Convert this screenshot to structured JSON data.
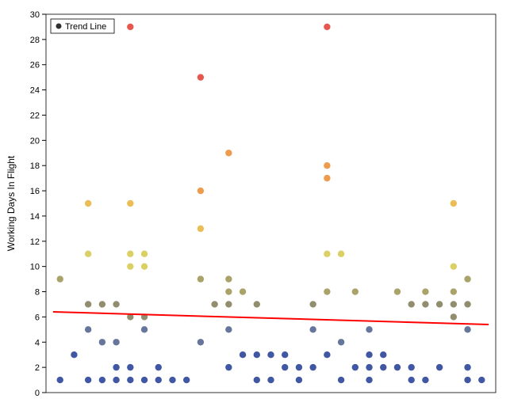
{
  "chart_data": {
    "type": "scatter",
    "title": "",
    "xlabel": "",
    "ylabel": "Working Days In Flight",
    "xlim": [
      0,
      32
    ],
    "ylim": [
      0,
      30
    ],
    "yticks": [
      0,
      2,
      4,
      6,
      8,
      10,
      12,
      14,
      16,
      18,
      20,
      22,
      24,
      26,
      28,
      30
    ],
    "legend": {
      "items": [
        "Trend Line"
      ],
      "position": "top-left"
    },
    "trend_line": {
      "x1": 0.5,
      "y1": 6.4,
      "x2": 31.5,
      "y2": 5.4,
      "color": "#ff0000"
    },
    "points": [
      {
        "x": 1,
        "y": 1
      },
      {
        "x": 1,
        "y": 9
      },
      {
        "x": 2,
        "y": 3
      },
      {
        "x": 3,
        "y": 1
      },
      {
        "x": 3,
        "y": 5
      },
      {
        "x": 3,
        "y": 7
      },
      {
        "x": 3,
        "y": 11
      },
      {
        "x": 3,
        "y": 15
      },
      {
        "x": 4,
        "y": 1
      },
      {
        "x": 4,
        "y": 4
      },
      {
        "x": 4,
        "y": 7
      },
      {
        "x": 5,
        "y": 1
      },
      {
        "x": 5,
        "y": 2
      },
      {
        "x": 5,
        "y": 4
      },
      {
        "x": 5,
        "y": 7
      },
      {
        "x": 6,
        "y": 1
      },
      {
        "x": 6,
        "y": 2
      },
      {
        "x": 6,
        "y": 6
      },
      {
        "x": 6,
        "y": 10
      },
      {
        "x": 6,
        "y": 11
      },
      {
        "x": 6,
        "y": 15
      },
      {
        "x": 6,
        "y": 29
      },
      {
        "x": 7,
        "y": 1
      },
      {
        "x": 7,
        "y": 5
      },
      {
        "x": 7,
        "y": 6
      },
      {
        "x": 7,
        "y": 10
      },
      {
        "x": 7,
        "y": 11
      },
      {
        "x": 8,
        "y": 1
      },
      {
        "x": 8,
        "y": 2
      },
      {
        "x": 9,
        "y": 1
      },
      {
        "x": 10,
        "y": 1
      },
      {
        "x": 11,
        "y": 4
      },
      {
        "x": 11,
        "y": 9
      },
      {
        "x": 11,
        "y": 13
      },
      {
        "x": 11,
        "y": 16
      },
      {
        "x": 11,
        "y": 25
      },
      {
        "x": 12,
        "y": 7
      },
      {
        "x": 13,
        "y": 2
      },
      {
        "x": 13,
        "y": 5
      },
      {
        "x": 13,
        "y": 7
      },
      {
        "x": 13,
        "y": 8
      },
      {
        "x": 13,
        "y": 9
      },
      {
        "x": 13,
        "y": 19
      },
      {
        "x": 14,
        "y": 3
      },
      {
        "x": 14,
        "y": 8
      },
      {
        "x": 15,
        "y": 1
      },
      {
        "x": 15,
        "y": 3
      },
      {
        "x": 15,
        "y": 7
      },
      {
        "x": 16,
        "y": 1
      },
      {
        "x": 16,
        "y": 3
      },
      {
        "x": 17,
        "y": 2
      },
      {
        "x": 17,
        "y": 3
      },
      {
        "x": 18,
        "y": 1
      },
      {
        "x": 18,
        "y": 2
      },
      {
        "x": 19,
        "y": 2
      },
      {
        "x": 19,
        "y": 5
      },
      {
        "x": 19,
        "y": 7
      },
      {
        "x": 20,
        "y": 3
      },
      {
        "x": 20,
        "y": 8
      },
      {
        "x": 20,
        "y": 11
      },
      {
        "x": 20,
        "y": 17
      },
      {
        "x": 20,
        "y": 18
      },
      {
        "x": 20,
        "y": 29
      },
      {
        "x": 21,
        "y": 1
      },
      {
        "x": 21,
        "y": 4
      },
      {
        "x": 21,
        "y": 11
      },
      {
        "x": 22,
        "y": 2
      },
      {
        "x": 22,
        "y": 8
      },
      {
        "x": 23,
        "y": 1
      },
      {
        "x": 23,
        "y": 2
      },
      {
        "x": 23,
        "y": 3
      },
      {
        "x": 23,
        "y": 5
      },
      {
        "x": 24,
        "y": 2
      },
      {
        "x": 24,
        "y": 3
      },
      {
        "x": 25,
        "y": 2
      },
      {
        "x": 25,
        "y": 8
      },
      {
        "x": 26,
        "y": 1
      },
      {
        "x": 26,
        "y": 2
      },
      {
        "x": 26,
        "y": 7
      },
      {
        "x": 27,
        "y": 1
      },
      {
        "x": 27,
        "y": 7
      },
      {
        "x": 27,
        "y": 8
      },
      {
        "x": 28,
        "y": 2
      },
      {
        "x": 28,
        "y": 7
      },
      {
        "x": 29,
        "y": 6
      },
      {
        "x": 29,
        "y": 7
      },
      {
        "x": 29,
        "y": 8
      },
      {
        "x": 29,
        "y": 10
      },
      {
        "x": 29,
        "y": 15
      },
      {
        "x": 30,
        "y": 1
      },
      {
        "x": 30,
        "y": 2
      },
      {
        "x": 30,
        "y": 5
      },
      {
        "x": 30,
        "y": 7
      },
      {
        "x": 30,
        "y": 9
      },
      {
        "x": 31,
        "y": 1
      }
    ]
  }
}
